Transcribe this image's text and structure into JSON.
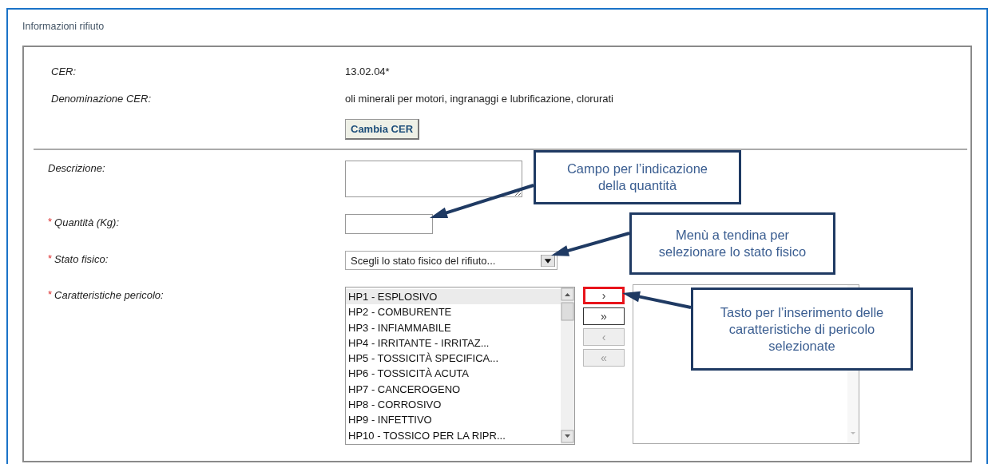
{
  "panel": {
    "title": "Informazioni rifiuto"
  },
  "info": [
    {
      "label": "CER:",
      "value": "13.02.04*"
    },
    {
      "label": "Denominazione CER:",
      "value": "oli minerali per motori, ingranaggi e lubrificazione, clorurati"
    }
  ],
  "change_button": "Cambia CER",
  "fields": [
    {
      "kind": "textarea",
      "label": "Descrizione:"
    },
    {
      "kind": "text",
      "label": "Quantità (Kg):",
      "mark": "*"
    },
    {
      "kind": "select",
      "label": "Stato fisico:",
      "mark": "*",
      "value": "Scegli lo stato fisico del rifiuto..."
    },
    {
      "kind": "transfer",
      "label": "Caratteristiche pericolo:",
      "mark": "*"
    }
  ],
  "hazard_list": [
    {
      "label": "HP1 - ESPLOSIVO",
      "selected": true
    },
    {
      "label": "HP2 - COMBURENTE",
      "selected": false
    },
    {
      "label": "HP3 - INFIAMMABILE",
      "selected": false
    },
    {
      "label": "HP4 - IRRITANTE - IRRITAZ...",
      "selected": false
    },
    {
      "label": "HP5 - TOSSICITÀ SPECIFICA...",
      "selected": false
    },
    {
      "label": "HP6 - TOSSICITÀ ACUTA",
      "selected": false
    },
    {
      "label": "HP7 - CANCEROGENO",
      "selected": false
    },
    {
      "label": "HP8 - CORROSIVO",
      "selected": false
    },
    {
      "label": "HP9 - INFETTIVO",
      "selected": false
    },
    {
      "label": "HP10 - TOSSICO PER LA RIPR...",
      "selected": false
    }
  ],
  "transfer_buttons": [
    {
      "label": "›",
      "disabled": false,
      "highlighted": true
    },
    {
      "label": "»",
      "disabled": false,
      "highlighted": false
    },
    {
      "label": "‹",
      "disabled": true,
      "highlighted": false
    },
    {
      "label": "«",
      "disabled": true,
      "highlighted": false
    }
  ],
  "callouts": [
    {
      "text": "Campo per l’indicazione della quantità"
    },
    {
      "text": "Menù a tendina per selezionare lo stato fisico"
    },
    {
      "text": "Tasto per l’inserimento delle caratteristiche di pericolo selezionate"
    }
  ]
}
